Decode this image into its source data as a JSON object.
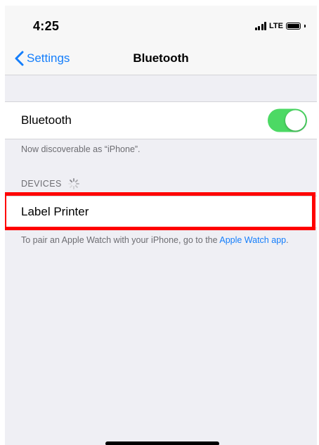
{
  "status_bar": {
    "time": "4:25",
    "network": "LTE"
  },
  "nav": {
    "back_label": "Settings",
    "title": "Bluetooth"
  },
  "bluetooth_row": {
    "label": "Bluetooth",
    "enabled": true,
    "toggle_color": "#4cd964"
  },
  "discoverable_text": "Now discoverable as “iPhone”.",
  "devices_section": {
    "header": "DEVICES",
    "items": [
      {
        "label": "Label Printer"
      }
    ]
  },
  "pair_note": {
    "text": "To pair an Apple Watch with your iPhone, go to the ",
    "link": "Apple Watch app",
    "suffix": "."
  },
  "colors": {
    "accent": "#147efb",
    "highlight": "#ff0000",
    "background": "#efeff4"
  }
}
